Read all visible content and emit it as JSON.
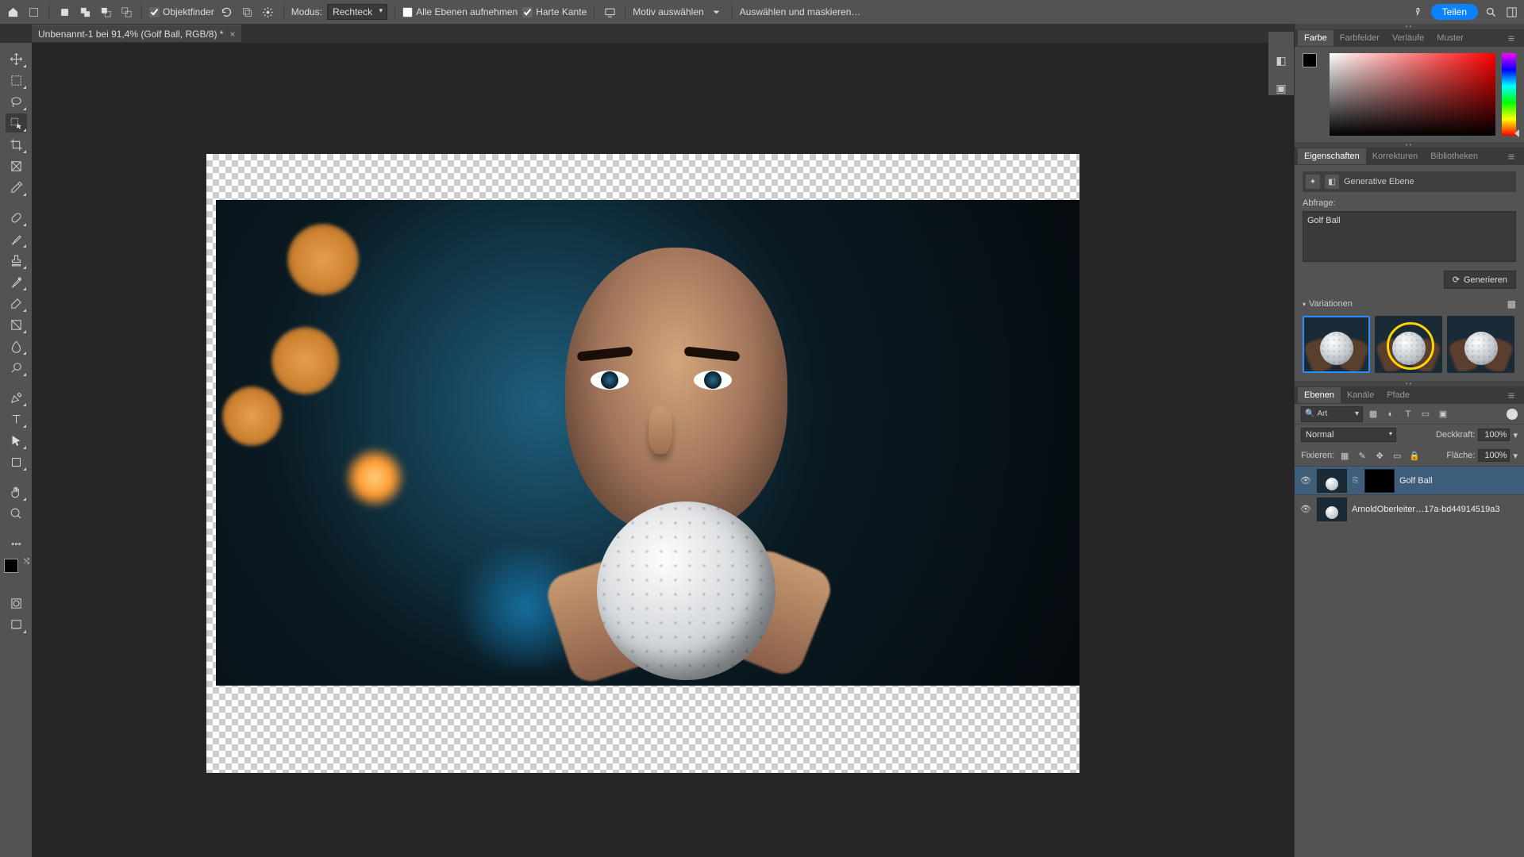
{
  "topbar": {
    "objectfinder": "Objektfinder",
    "modus_label": "Modus:",
    "modus_value": "Rechteck",
    "alle_ebenen": "Alle Ebenen aufnehmen",
    "harte_kante": "Harte Kante",
    "motiv": "Motiv auswählen",
    "maskieren": "Auswählen und maskieren…",
    "teilen": "Teilen"
  },
  "tab": {
    "title": "Unbenannt-1 bei 91,4% (Golf Ball, RGB/8) *"
  },
  "color_tab": {
    "farbe": "Farbe",
    "farbfelder": "Farbfelder",
    "verlaeufe": "Verläufe",
    "muster": "Muster"
  },
  "props_tab": {
    "eigenschaften": "Eigenschaften",
    "korrekturen": "Korrekturen",
    "bibliotheken": "Bibliotheken"
  },
  "props": {
    "gen_layer": "Generative Ebene",
    "abfrage_label": "Abfrage:",
    "abfrage_value": "Golf Ball",
    "generieren": "Generieren",
    "variationen": "Variationen"
  },
  "layers_tab": {
    "ebenen": "Ebenen",
    "kanaele": "Kanäle",
    "pfade": "Pfade"
  },
  "layers": {
    "filter_kind": "Art",
    "blend": "Normal",
    "deckkraft_label": "Deckkraft:",
    "deckkraft_value": "100%",
    "fixieren_label": "Fixieren:",
    "flaeche_label": "Fläche:",
    "flaeche_value": "100%",
    "items": [
      {
        "name": "Golf Ball"
      },
      {
        "name": "ArnoldOberleiter…17a-bd44914519a3"
      }
    ]
  }
}
